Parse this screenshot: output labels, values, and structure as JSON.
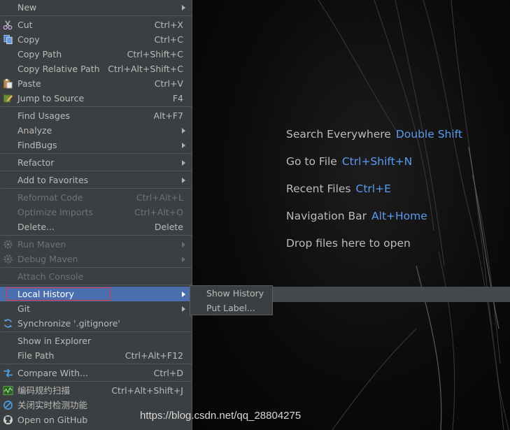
{
  "menu": {
    "items": [
      {
        "label": "New",
        "shortcut": "",
        "submenu": true
      },
      {
        "label": "Cut",
        "shortcut": "Ctrl+X",
        "icon": "scissors-icon"
      },
      {
        "label": "Copy",
        "shortcut": "Ctrl+C",
        "icon": "copy-icon"
      },
      {
        "label": "Copy Path",
        "shortcut": "Ctrl+Shift+C"
      },
      {
        "label": "Copy Relative Path",
        "shortcut": "Ctrl+Alt+Shift+C"
      },
      {
        "label": "Paste",
        "shortcut": "Ctrl+V",
        "icon": "paste-icon"
      },
      {
        "label": "Jump to Source",
        "shortcut": "F4",
        "icon": "edit-pencil-icon"
      },
      {
        "label": "Find Usages",
        "shortcut": "Alt+F7"
      },
      {
        "label": "Analyze",
        "submenu": true
      },
      {
        "label": "FindBugs",
        "submenu": true
      },
      {
        "label": "Refactor",
        "submenu": true
      },
      {
        "label": "Add to Favorites",
        "submenu": true
      },
      {
        "label": "Reformat Code",
        "shortcut": "Ctrl+Alt+L",
        "disabled": true
      },
      {
        "label": "Optimize Imports",
        "shortcut": "Ctrl+Alt+O",
        "disabled": true
      },
      {
        "label": "Delete...",
        "shortcut": "Delete"
      },
      {
        "label": "Run Maven",
        "submenu": true,
        "disabled": true,
        "icon": "gear-icon"
      },
      {
        "label": "Debug Maven",
        "submenu": true,
        "disabled": true,
        "icon": "gear-icon"
      },
      {
        "label": "Attach Console",
        "disabled": true
      },
      {
        "label": "Local History",
        "submenu": true,
        "selected": true
      },
      {
        "label": "Git",
        "submenu": true
      },
      {
        "label": "Synchronize '.gitignore'",
        "icon": "sync-icon"
      },
      {
        "label": "Show in Explorer"
      },
      {
        "label": "File Path",
        "shortcut": "Ctrl+Alt+F12"
      },
      {
        "label": "Compare With...",
        "shortcut": "Ctrl+D",
        "icon": "compare-icon"
      },
      {
        "label": "编码规约扫描",
        "shortcut": "Ctrl+Alt+Shift+J",
        "icon": "scan-icon"
      },
      {
        "label": "关闭实时检测功能",
        "icon": "disable-icon"
      },
      {
        "label": "Open on GitHub",
        "icon": "github-icon"
      }
    ]
  },
  "submenu": {
    "items": [
      {
        "label": "Show History"
      },
      {
        "label": "Put Label..."
      }
    ]
  },
  "editor": {
    "hints": [
      {
        "text": "Search Everywhere",
        "key": "Double Shift"
      },
      {
        "text": "Go to File",
        "key": "Ctrl+Shift+N"
      },
      {
        "text": "Recent Files",
        "key": "Ctrl+E"
      },
      {
        "text": "Navigation Bar",
        "key": "Alt+Home"
      },
      {
        "text": "Drop files here to open",
        "key": ""
      }
    ]
  },
  "watermark": "https://blog.csdn.net/qq_28804275",
  "colors": {
    "menu_bg": "#3c3f41",
    "selection": "#4b6eaf",
    "shortcut_hint": "#5b9bf0",
    "outline": "#e0333a"
  }
}
